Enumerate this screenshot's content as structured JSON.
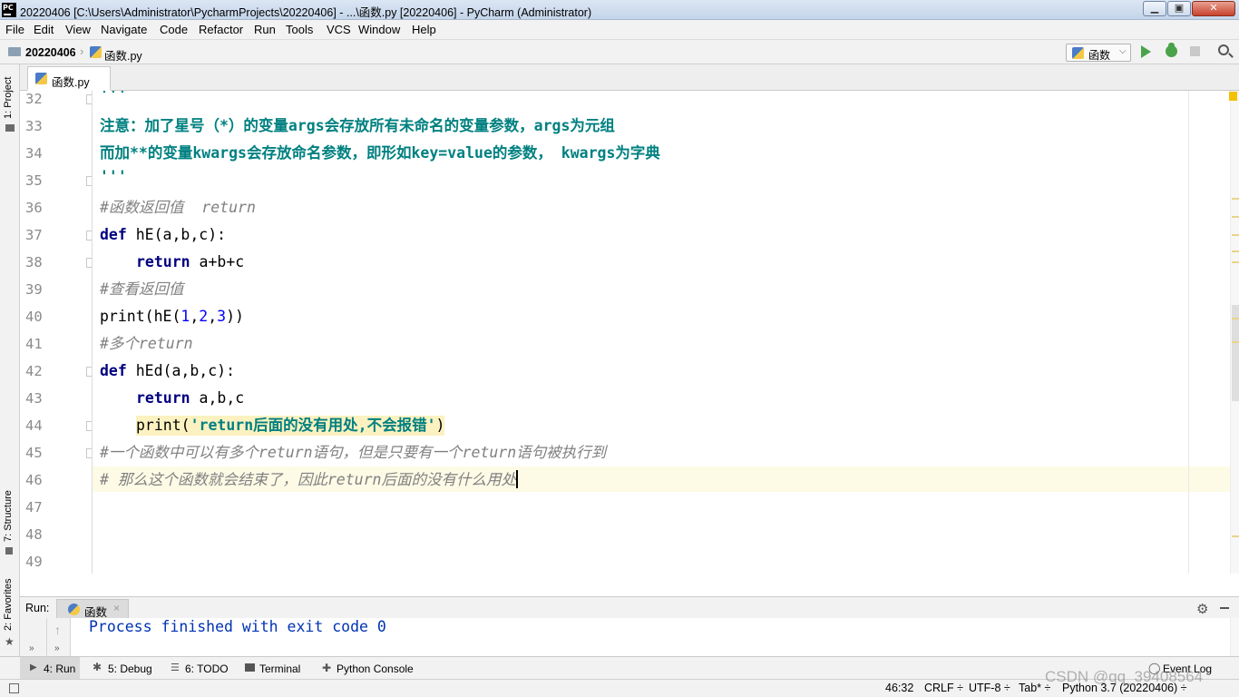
{
  "window": {
    "title": "20220406 [C:\\Users\\Administrator\\PycharmProjects\\20220406] - ...\\函数.py [20220406] - PyCharm (Administrator)",
    "app_icon_text": "PC"
  },
  "menu": [
    "File",
    "Edit",
    "View",
    "Navigate",
    "Code",
    "Refactor",
    "Run",
    "Tools",
    "VCS",
    "Window",
    "Help"
  ],
  "navbar": {
    "project": "20220406",
    "file": "函数.py",
    "run_config": "函数"
  },
  "left_tool_windows": {
    "project": "1: Project",
    "structure": "7: Structure",
    "favorites": "2: Favorites"
  },
  "editor": {
    "tab_label": "函数.py",
    "current_line": 46,
    "lines": [
      {
        "no": "32",
        "text": "'''"
      },
      {
        "no": "33",
        "text": "注意：加了星号（*）的变量args会存放所有未命名的变量参数，args为元组"
      },
      {
        "no": "34",
        "text": "而加**的变量kwargs会存放命名参数，即形如key=value的参数， kwargs为字典"
      },
      {
        "no": "35",
        "text": "'''"
      },
      {
        "no": "36",
        "text": "#函数返回值  return"
      },
      {
        "no": "37",
        "kw": "def",
        "rest": " hE(a,b,c):"
      },
      {
        "no": "38",
        "kw": "return",
        "rest": " a+b+c"
      },
      {
        "no": "39",
        "text": "#查看返回值"
      },
      {
        "no": "40",
        "p1": "print(hE(",
        "n1": "1",
        "c1": ",",
        "n2": "2",
        "c2": ",",
        "n3": "3",
        "p2": "))"
      },
      {
        "no": "41",
        "text": "#多个return"
      },
      {
        "no": "42",
        "kw": "def",
        "rest": " hEd(a,b,c):"
      },
      {
        "no": "43",
        "kw": "return",
        "rest": " a,b,c"
      },
      {
        "no": "44",
        "p1": "print(",
        "str": "'return后面的没有用处,不会报错'",
        "p2": ")"
      },
      {
        "no": "45",
        "text": "#一个函数中可以有多个return语句，但是只要有一个return语句被执行到"
      },
      {
        "no": "46",
        "text": "# 那么这个函数就会结束了，因此return后面的没有什么用处"
      },
      {
        "no": "47",
        "text": ""
      },
      {
        "no": "48",
        "text": ""
      },
      {
        "no": "49",
        "text": ""
      }
    ]
  },
  "run_panel": {
    "label": "Run:",
    "tab": "函数",
    "output": "Process finished with exit code 0"
  },
  "tool_tabs": [
    {
      "key": "4",
      "label": "4: Run"
    },
    {
      "key": "5",
      "label": "5: Debug"
    },
    {
      "key": "6",
      "label": "6: TODO"
    },
    {
      "key": "t",
      "label": "Terminal"
    },
    {
      "key": "p",
      "label": "Python Console"
    }
  ],
  "event_log": "Event Log",
  "status": {
    "position": "46:32",
    "line_sep": "CRLF ÷",
    "encoding": "UTF-8 ÷",
    "indent": "Tab* ÷",
    "interpreter": "Python 3.7 (20220406) ÷"
  },
  "watermark": "CSDN @qq_39408564",
  "colors": {
    "keyword": "#000080",
    "string": "#008080",
    "comment": "#808080",
    "number": "#0000ff",
    "run_green": "#4aa34a",
    "current_line_bg": "#fdfbe6"
  }
}
